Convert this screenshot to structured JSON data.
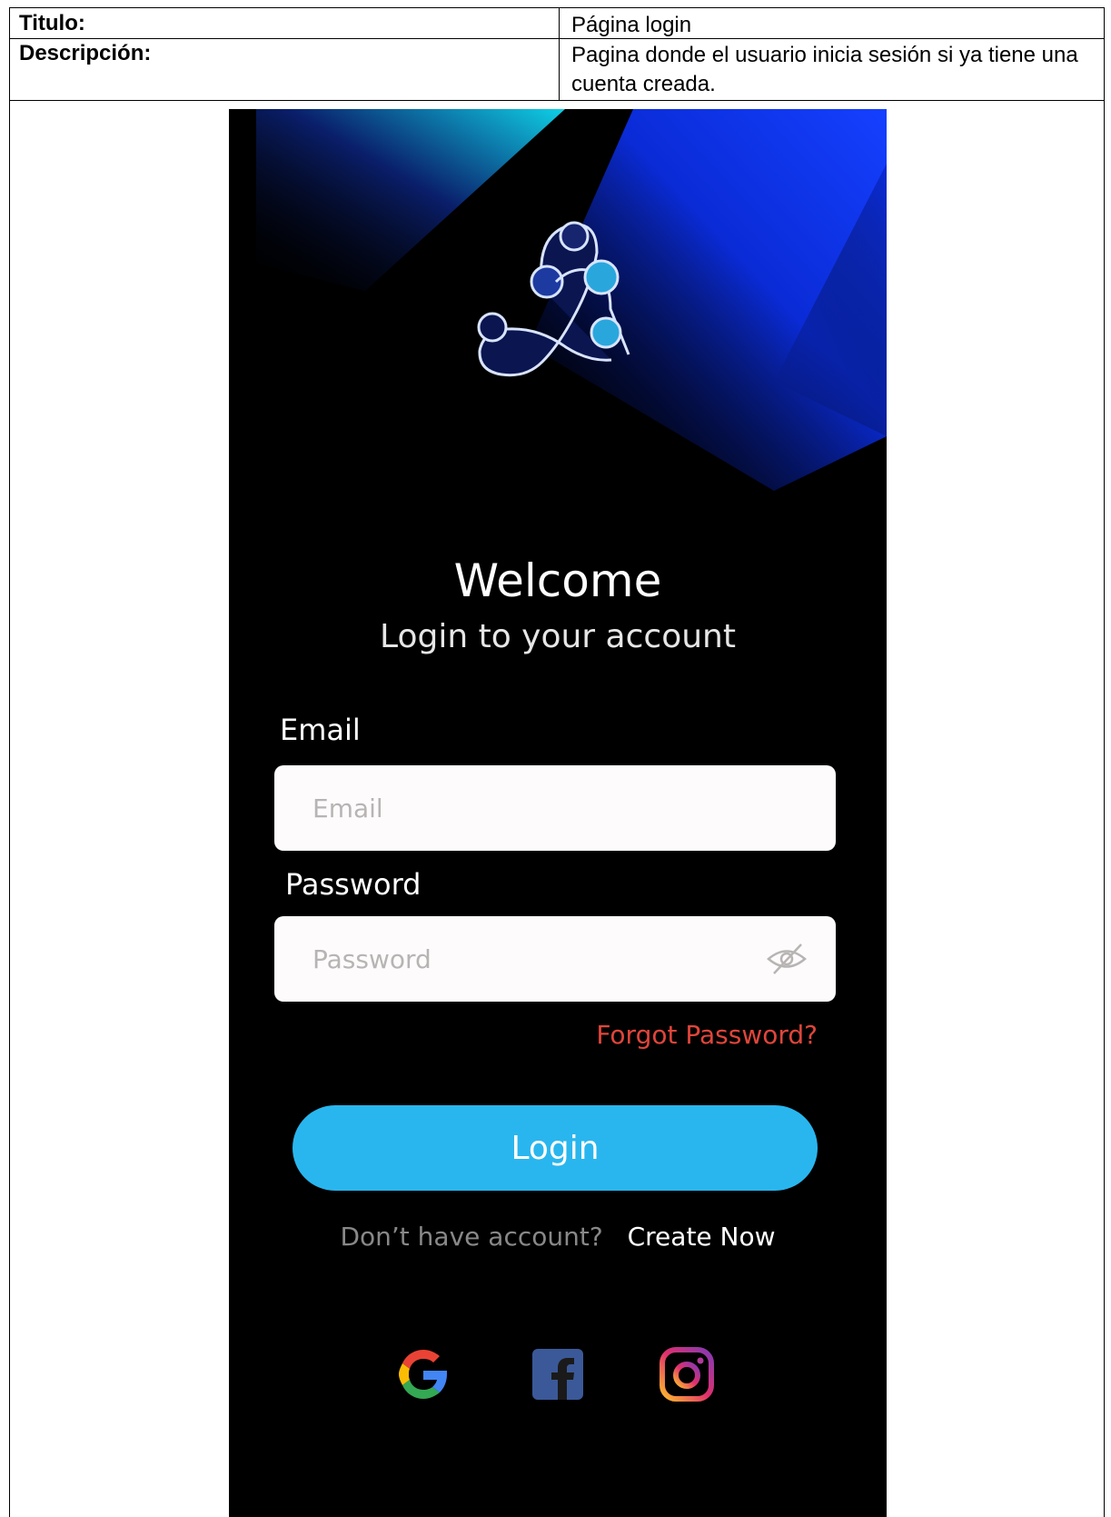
{
  "document": {
    "title_label": "Titulo:",
    "title_value": "Página login",
    "description_label": "Descripción:",
    "description_value": "Pagina donde el usuario inicia sesión si ya tiene una cuenta creada."
  },
  "screen": {
    "welcome": "Welcome",
    "subtitle": "Login to your account",
    "email_label": "Email",
    "email_placeholder": "Email",
    "password_label": "Password",
    "password_placeholder": "Password",
    "forgot_password": "Forgot Password?",
    "login_button": "Login",
    "no_account_text": "Don’t have account?",
    "create_now": "Create Now",
    "social": [
      "google-icon",
      "facebook-icon",
      "instagram-icon"
    ],
    "colors": {
      "background": "#000000",
      "accent": "#29b6ee",
      "forgot": "#e0453b",
      "gradient_blue": "#0a2bd6",
      "gradient_cyan": "#0fd0e6"
    }
  }
}
